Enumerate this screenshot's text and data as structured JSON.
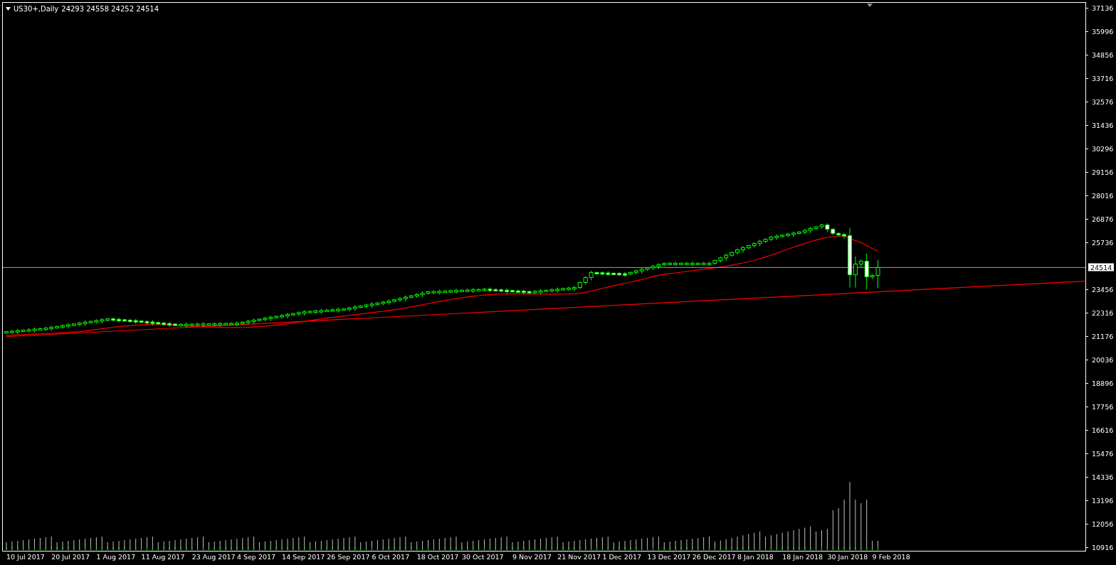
{
  "header": {
    "symbol": "US30+,Daily",
    "quote": "24293 24558 24252 24514"
  },
  "chart": {
    "moving_average": {
      "color": "#ff0000"
    },
    "trendline": {
      "color": "#ff0000"
    }
  },
  "price_axis": {
    "labels": [
      "37136",
      "35996",
      "34856",
      "33716",
      "32576",
      "31436",
      "30296",
      "29156",
      "28016",
      "26876",
      "25736",
      "23456",
      "22316",
      "21176",
      "20036",
      "18896",
      "17756",
      "16616",
      "15476",
      "14336",
      "13196",
      "12056",
      "10916"
    ],
    "current_price": "24514"
  },
  "time_axis": {
    "labels": [
      "10 Jul 2017",
      "20 Jul 2017",
      "1 Aug 2017",
      "11 Aug 2017",
      "23 Aug 2017",
      "4 Sep 2017",
      "14 Sep 2017",
      "26 Sep 2017",
      "6 Oct 2017",
      "18 Oct 2017",
      "30 Oct 2017",
      "9 Nov 2017",
      "21 Nov 2017",
      "1 Dec 2017",
      "13 Dec 2017",
      "26 Dec 2017",
      "8 Jan 2018",
      "18 Jan 2018",
      "30 Jan 2018",
      "9 Feb 2018"
    ]
  }
}
